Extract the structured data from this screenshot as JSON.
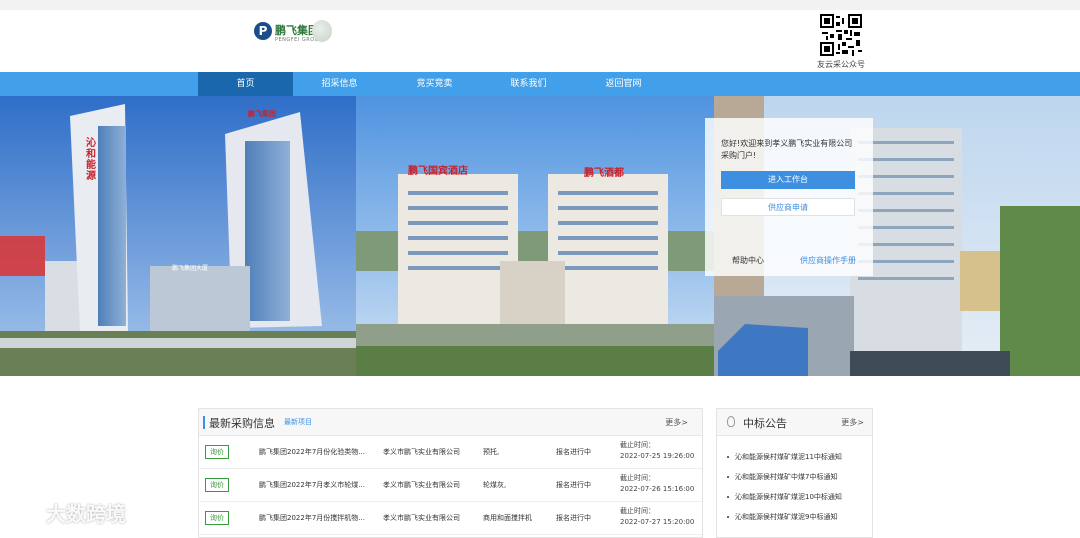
{
  "logo": {
    "mark": "P",
    "name_cn": "鹏飞集团",
    "name_en": "PENGFEI GROUP"
  },
  "qr": {
    "caption": "友云采公众号"
  },
  "nav": {
    "items": [
      "首页",
      "招采信息",
      "竞买竞卖",
      "联系我们",
      "返回官网"
    ],
    "active": 0
  },
  "banner": {
    "sign_left_tower": "沁和能源",
    "sign_left_tower2": "鹏飞集团大厦",
    "sign_center_left": "鹏飞国宾酒店",
    "sign_center_right": "鹏飞酒都",
    "sign_right_tower": "鹏飞集团"
  },
  "login": {
    "welcome": "您好!欢迎来到孝义鹏飞实业有限公司采购门户!",
    "enter_button": "进入工作台",
    "apply_button": "供应商申请",
    "help_link": "帮助中心",
    "manual_link": "供应商操作手册"
  },
  "procurement": {
    "title": "最新采购信息",
    "subtitle": "最新项目",
    "more": "更多>",
    "rows": [
      {
        "badge": "询价",
        "name": "鹏飞集团2022年7月份化验类物...",
        "company": "孝义市鹏飞实业有限公司",
        "item": "预托,",
        "status": "报名进行中",
        "deadline_label": "截止时间：",
        "deadline": "2022-07-25 19:26:00"
      },
      {
        "badge": "询价",
        "name": "鹏飞集团2022年7月孝义市轮煤...",
        "company": "孝义市鹏飞实业有限公司",
        "item": "轮煤灰,",
        "status": "报名进行中",
        "deadline_label": "截止时间：",
        "deadline": "2022-07-26 15:16:00"
      },
      {
        "badge": "询价",
        "name": "鹏飞集团2022年7月份搅拌机物...",
        "company": "孝义市鹏飞实业有限公司",
        "item": "商用和面搅拌机",
        "status": "报名进行中",
        "deadline_label": "截止时间：",
        "deadline": "2022-07-27 15:20:00"
      }
    ]
  },
  "awards": {
    "title": "中标公告",
    "more": "更多>",
    "items": [
      "沁和能源侯村煤矿煤泥11中标通知",
      "沁和能源侯村煤矿中煤7中标通知",
      "沁和能源侯村煤矿煤泥10中标通知",
      "沁和能源侯村煤矿煤泥9中标通知"
    ]
  },
  "watermark": "大数跨境"
}
